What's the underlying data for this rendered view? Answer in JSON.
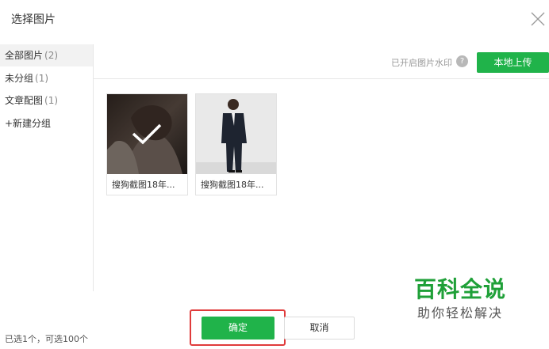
{
  "dialog": {
    "title": "选择图片",
    "close_icon": "close-icon"
  },
  "sidebar": {
    "items": [
      {
        "label": "全部图片",
        "count": "(2)",
        "active": true
      },
      {
        "label": "未分组",
        "count": "(1)",
        "active": false
      },
      {
        "label": "文章配图",
        "count": "(1)",
        "active": false
      }
    ],
    "new_group": {
      "icon": "plus-icon",
      "label": "+新建分组"
    }
  },
  "toolbar": {
    "watermark_text": "已开启图片水印",
    "help_icon": "?",
    "upload_label": "本地上传",
    "accent": "#20b34a"
  },
  "images": [
    {
      "caption": "搜狗截图18年...",
      "selected": true
    },
    {
      "caption": "搜狗截图18年...",
      "selected": false
    }
  ],
  "brand": {
    "main": "百科全说",
    "sub": "助你轻松解决",
    "color": "#1fa038"
  },
  "footer": {
    "status": "已选1个，可选100个",
    "confirm_label": "确定",
    "cancel_label": "取消",
    "highlight_color": "#e03b3b"
  }
}
